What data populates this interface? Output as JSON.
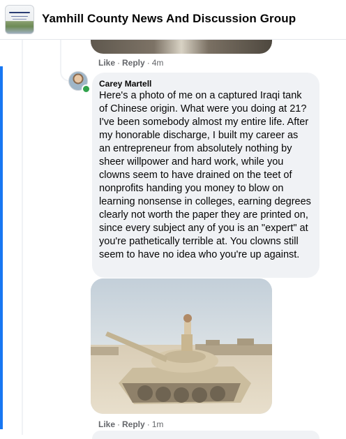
{
  "header": {
    "group_name": "Yamhill County News And Discussion Group",
    "logo_icon": "group-cover-thumbnail"
  },
  "previous_comment": {
    "actions": {
      "like": "Like",
      "reply": "Reply",
      "time": "4m"
    }
  },
  "comment": {
    "author": "Carey Martell",
    "text": "Here's a photo of me on a captured Iraqi tank of Chinese origin. What were you doing at 21? I've been somebody almost my entire life. After my honorable discharge, I built my career as an entrepreneur from absolutely nothing by sheer willpower and hard work, while you clowns seem to have drained on the teet of nonprofits handing you money to blow on learning nonsense in colleges, earning degrees clearly not worth the paper they are printed on, since every subject any of you is an \"expert\" at you're pathetically terrible at. You clowns still seem to have no idea who you're up against.",
    "photo_icon": "tank-photo",
    "actions": {
      "like": "Like",
      "reply": "Reply",
      "time": "1m"
    }
  },
  "colors": {
    "accent": "#1877f2",
    "bubble": "#f0f2f5",
    "muted_text": "#65676b",
    "online": "#31a24c"
  }
}
